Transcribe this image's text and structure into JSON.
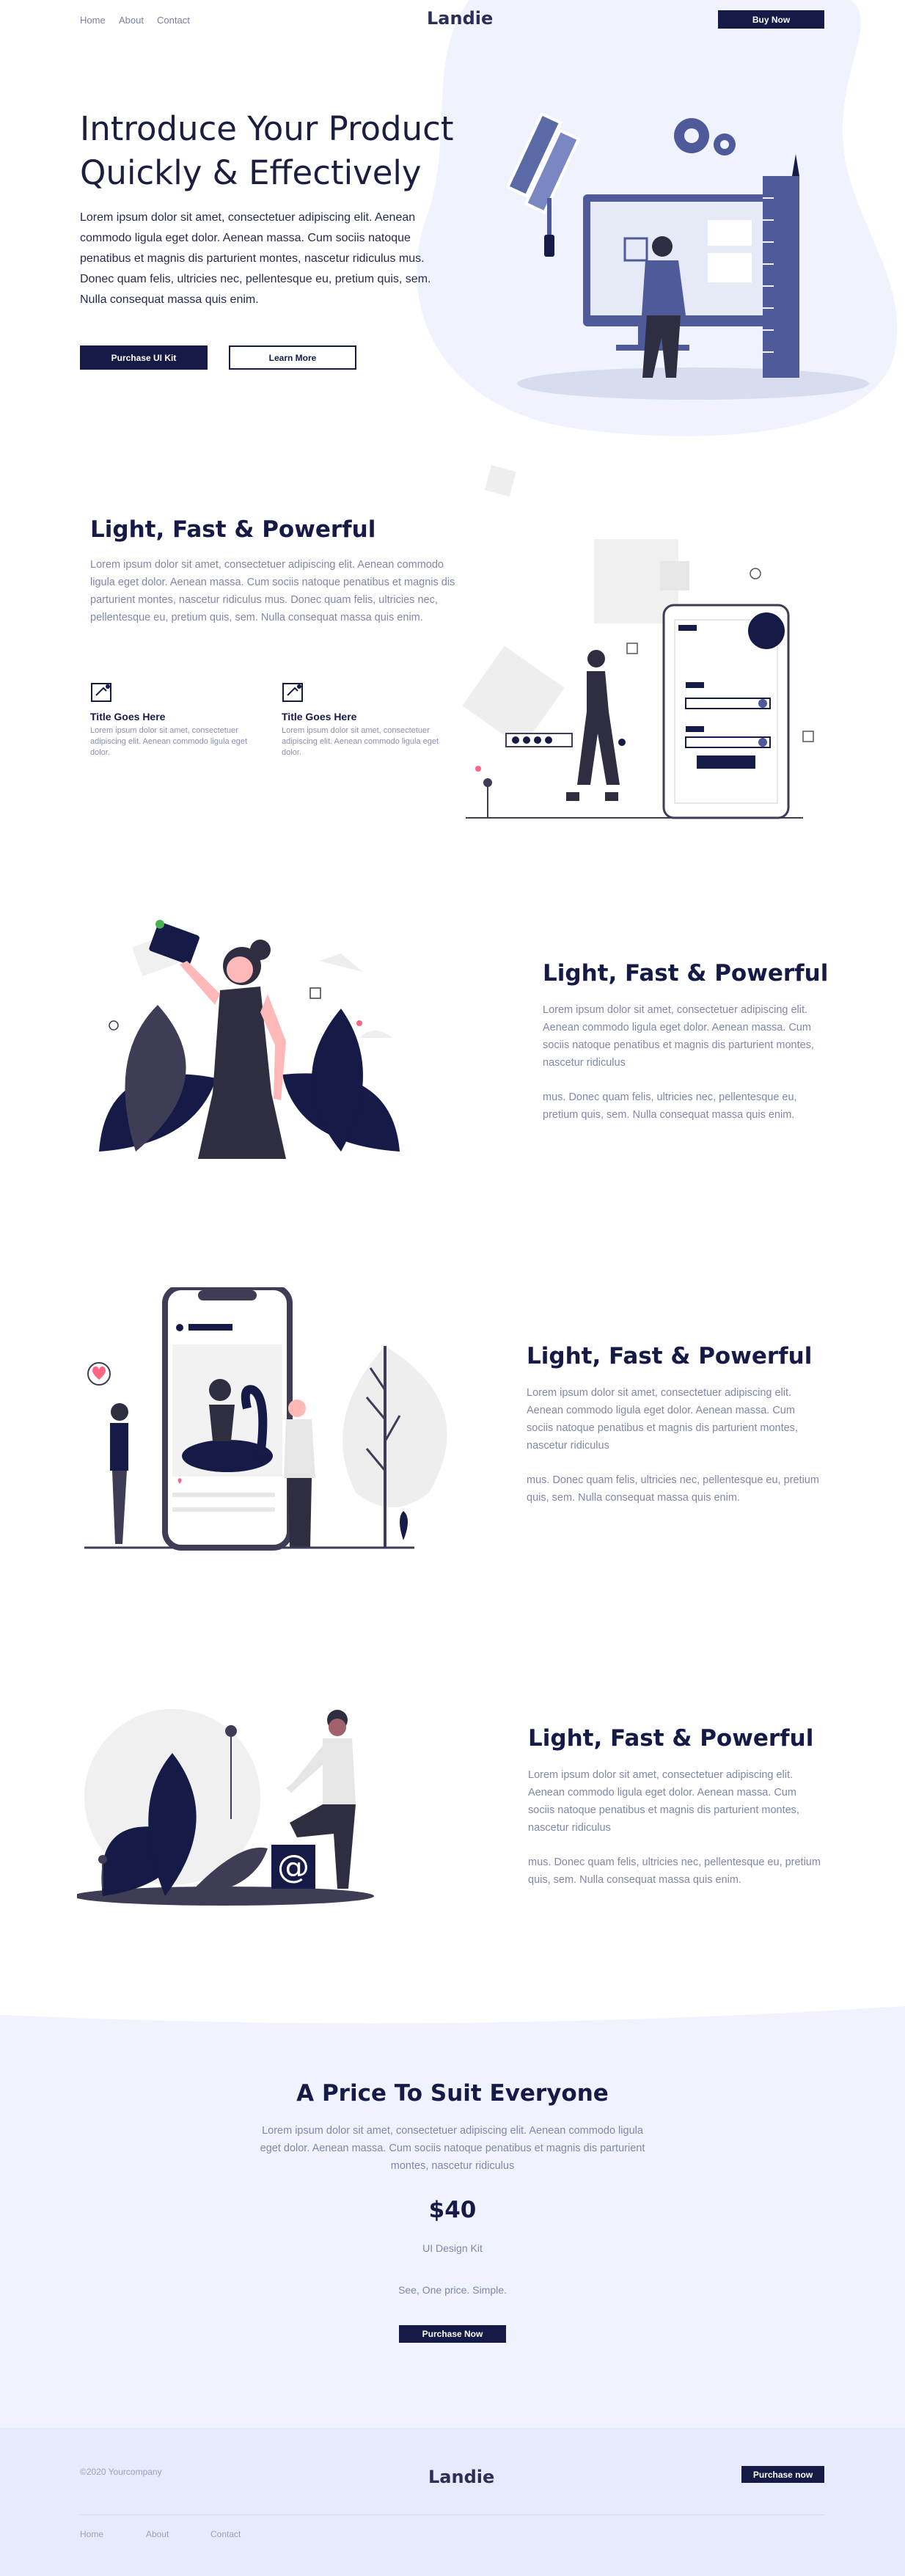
{
  "header": {
    "nav": [
      "Home",
      "About",
      "Contact"
    ],
    "logo": "Landie",
    "buy_label": "Buy Now"
  },
  "hero": {
    "title_line1": "Introduce Your Product",
    "title_line2": "Quickly & Effectively",
    "text": "Lorem ipsum dolor sit amet, consectetuer adipiscing elit. Aenean commodo ligula eget dolor. Aenean massa. Cum sociis natoque penatibus et magnis dis parturient montes, nascetur ridiculus mus. Donec quam felis, ultricies nec, pellentesque eu, pretium quis, sem. Nulla consequat massa quis enim.",
    "primary_label": "Purchase UI Kit",
    "secondary_label": "Learn More"
  },
  "section1": {
    "title": "Light, Fast & Powerful",
    "text": "Lorem ipsum dolor sit amet, consectetuer adipiscing elit. Aenean commodo ligula eget dolor. Aenean massa. Cum sociis natoque penatibus et magnis dis parturient montes, nascetur ridiculus mus. Donec quam felis, ultricies nec, pellentesque eu, pretium quis, sem. Nulla consequat massa quis enim.",
    "features": [
      {
        "title": "Title Goes Here",
        "text": "Lorem ipsum dolor sit amet, consectetuer adipiscing elit. Aenean commodo ligula eget dolor."
      },
      {
        "title": "Title Goes Here",
        "text": "Lorem ipsum dolor sit amet, consectetuer adipiscing elit. Aenean commodo ligula eget dolor."
      }
    ]
  },
  "section2": {
    "title": "Light, Fast & Powerful",
    "text1": "Lorem ipsum dolor sit amet, consectetuer adipiscing elit. Aenean commodo ligula eget dolor. Aenean massa. Cum sociis natoque penatibus et magnis dis parturient montes, nascetur ridiculus",
    "text2": "mus. Donec quam felis, ultricies nec, pellentesque eu, pretium quis, sem. Nulla consequat massa quis enim."
  },
  "section3": {
    "title": "Light, Fast & Powerful",
    "text1": "Lorem ipsum dolor sit amet, consectetuer adipiscing elit. Aenean commodo ligula eget dolor. Aenean massa. Cum sociis natoque penatibus et magnis dis parturient montes, nascetur ridiculus",
    "text2": "mus. Donec quam felis, ultricies nec, pellentesque eu, pretium quis, sem. Nulla consequat massa quis enim."
  },
  "section4": {
    "title": "Light, Fast & Powerful",
    "text1": "Lorem ipsum dolor sit amet, consectetuer adipiscing elit. Aenean commodo ligula eget dolor. Aenean massa. Cum sociis natoque penatibus et magnis dis parturient montes, nascetur ridiculus",
    "text2": "mus. Donec quam felis, ultricies nec, pellentesque eu, pretium quis, sem. Nulla consequat massa quis enim."
  },
  "pricing": {
    "title": "A Price To Suit Everyone",
    "text": "Lorem ipsum dolor sit amet, consectetuer adipiscing elit. Aenean commodo ligula eget dolor. Aenean massa. Cum sociis natoque penatibus et magnis dis parturient montes, nascetur ridiculus",
    "price": "$40",
    "product": "UI Design Kit",
    "tagline": "See, One price. Simple.",
    "button_label": "Purchase Now"
  },
  "footer": {
    "copyright": "©2020 Yourcompany",
    "logo": "Landie",
    "button_label": "Purchase now",
    "links": [
      "Home",
      "About",
      "Contact"
    ]
  },
  "colors": {
    "navy": "#151a47",
    "blob": "#f0f2fd",
    "accent_blue": "#5a6aa6",
    "pink": "#ff6584",
    "footer_bg": "#e6eafb"
  }
}
